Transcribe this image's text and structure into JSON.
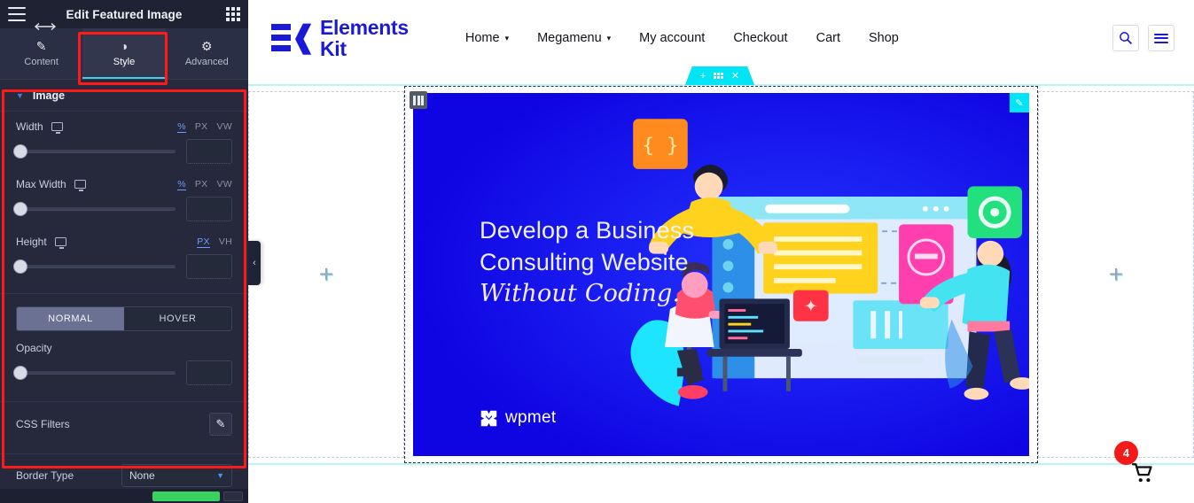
{
  "panel": {
    "title": "Edit Featured Image",
    "menu_icon": "hamburger-icon",
    "apps_icon": "grid-apps-icon",
    "resize_icon": "horizontal-resize-icon",
    "tabs": [
      {
        "label": "Content",
        "icon": "pencil-icon",
        "active": false
      },
      {
        "label": "Style",
        "icon": "contrast-half-circle-icon",
        "active": true
      },
      {
        "label": "Advanced",
        "icon": "gear-icon",
        "active": false
      }
    ],
    "section": {
      "title": "Image",
      "expanded": true
    },
    "controls": [
      {
        "label": "Width",
        "device_icon": "desktop-icon",
        "units": [
          {
            "label": "%",
            "active": true
          },
          {
            "label": "PX",
            "active": false
          },
          {
            "label": "VW",
            "active": false
          }
        ],
        "slider_value": "",
        "input_value": ""
      },
      {
        "label": "Max Width",
        "device_icon": "desktop-icon",
        "units": [
          {
            "label": "%",
            "active": true
          },
          {
            "label": "PX",
            "active": false
          },
          {
            "label": "VW",
            "active": false
          }
        ],
        "slider_value": "",
        "input_value": ""
      },
      {
        "label": "Height",
        "device_icon": "desktop-icon",
        "units": [
          {
            "label": "PX",
            "active": true
          },
          {
            "label": "VH",
            "active": false
          }
        ],
        "slider_value": "",
        "input_value": ""
      }
    ],
    "state_tabs": [
      {
        "label": "NORMAL",
        "active": true
      },
      {
        "label": "HOVER",
        "active": false
      }
    ],
    "opacity": {
      "label": "Opacity",
      "slider_value": "",
      "input_value": ""
    },
    "css_filters": {
      "label": "CSS Filters",
      "edit_icon": "pencil-edit-icon"
    },
    "border_type": {
      "label": "Border Type",
      "value": "None",
      "caret_icon": "chevron-down-icon"
    },
    "collapse_icon": "chevron-left-icon",
    "highlight_color": "#ff1a1a",
    "accent_color": "#3ad0e8"
  },
  "preview": {
    "logo": {
      "line1": "Elements",
      "line2": "Kit",
      "color": "#1a1ad6"
    },
    "nav": [
      {
        "label": "Home",
        "has_caret": true
      },
      {
        "label": "Megamenu",
        "has_caret": true
      },
      {
        "label": "My account",
        "has_caret": false
      },
      {
        "label": "Checkout",
        "has_caret": false
      },
      {
        "label": "Cart",
        "has_caret": false
      },
      {
        "label": "Shop",
        "has_caret": false
      }
    ],
    "header_icons": [
      {
        "name": "search-icon",
        "glyph": "⌕"
      },
      {
        "name": "menu-hamburger-icon",
        "glyph": ""
      }
    ],
    "section_toolbar": {
      "add_icon": "plus-icon",
      "drag_icon": "grid-dots-icon",
      "close_icon": "close-x-icon",
      "color": "#00e5f5"
    },
    "columns": {
      "left_placeholder": "+",
      "right_placeholder": "+",
      "column_handle_icon": "column-handle-icon"
    },
    "banner": {
      "edit_icon": "pencil-edit-icon",
      "headline_line1": "Develop a Business",
      "headline_line2": "Consulting Website",
      "headline_script": "Without Coding.",
      "brand": "wpmet",
      "brand_icon": "wpmet-logo-icon",
      "background_color": "#1414ee"
    },
    "cart": {
      "badge_count": "4",
      "icon": "shopping-cart-icon",
      "badge_color": "#f41a1a"
    }
  }
}
